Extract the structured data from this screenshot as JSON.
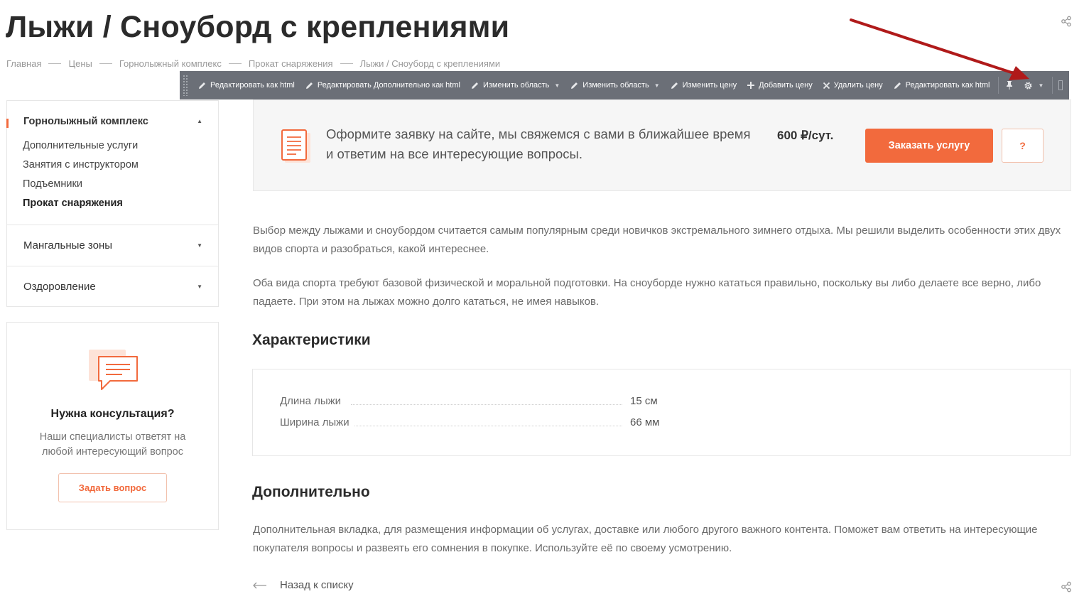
{
  "page": {
    "title": "Лыжи / Сноуборд с креплениями"
  },
  "breadcrumb": [
    "Главная",
    "Цены",
    "Горнолыжный комплекс",
    "Прокат снаряжения",
    "Лыжи / Сноуборд с креплениями"
  ],
  "toolbar": {
    "items": [
      {
        "label": "Редактировать как html",
        "icon": "pencil-icon"
      },
      {
        "label": "Редактировать Дополнительно как html",
        "icon": "pencil-icon"
      },
      {
        "label": "Изменить область",
        "icon": "pencil-icon",
        "dropdown": true
      },
      {
        "label": "Изменить область",
        "icon": "pencil-icon",
        "dropdown": true
      },
      {
        "label": "Изменить цену",
        "icon": "pencil-icon"
      },
      {
        "label": "Добавить цену",
        "icon": "plus-icon"
      },
      {
        "label": "Удалить цену",
        "icon": "x-icon"
      },
      {
        "label": "Редактировать как html",
        "icon": "pencil-icon"
      }
    ],
    "pin_icon": "pin-icon",
    "settings_icon": "gear-icon"
  },
  "sidebar": {
    "sections": [
      {
        "title": "Горнолыжный комплекс",
        "expanded": true,
        "items": [
          "Дополнительные услуги",
          "Занятия с инструктором",
          "Подъемники",
          "Прокат снаряжения"
        ],
        "active_item": "Прокат снаряжения"
      },
      {
        "title": "Мангальные зоны",
        "expanded": false
      },
      {
        "title": "Оздоровление",
        "expanded": false
      }
    ]
  },
  "consult": {
    "title": "Нужна консультация?",
    "text": "Наши специалисты ответят на любой интересующий вопрос",
    "button": "Задать вопрос"
  },
  "order": {
    "text": "Оформите заявку на сайте, мы свяжемся с вами в ближайшее время и ответим на все интересующие вопросы.",
    "price": "600 ₽/сут.",
    "button": "Заказать услугу",
    "question_button": "?"
  },
  "content": {
    "p1": "Выбор между лыжами и сноубордом считается самым популярным среди новичков экстремального зимнего отдыха. Мы решили выделить особенности этих двух видов спорта и разобраться, какой интереснее.",
    "p2": "Оба вида спорта требуют базовой физической и моральной подготовки. На сноуборде нужно кататься правильно, поскольку вы либо делаете все верно, либо падаете. При этом на лыжах можно долго кататься, не имея навыков.",
    "characteristics_title": "Характеристики",
    "characteristics": [
      {
        "name": "Длина лыжи",
        "value": "15 см"
      },
      {
        "name": "Ширина лыжи",
        "value": "66 мм"
      }
    ],
    "extra_title": "Дополнительно",
    "extra_text": "Дополнительная вкладка, для размещения информации об услугах, доставке или любого другого важного контента. Поможет вам ответить на интересующие покупателя вопросы и развеять его сомнения в покупке. Используйте её по своему усмотрению.",
    "back_link": "Назад к списку"
  },
  "colors": {
    "accent": "#f26a3d",
    "toolbar_bg": "#6b6f77",
    "annotation_arrow": "#b01a1a"
  }
}
